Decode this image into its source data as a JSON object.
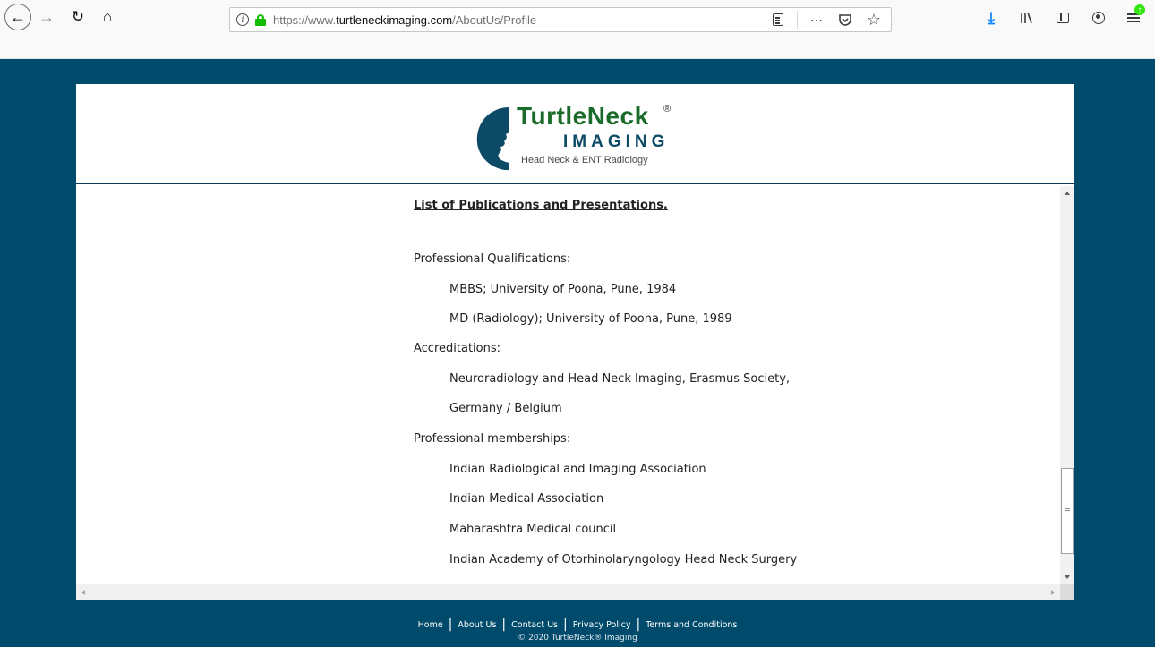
{
  "browser": {
    "url_prefix": "https://www.",
    "url_domain": "turtleneckimaging.com",
    "url_path": "/AboutUs/Profile",
    "icons": [
      "back-icon",
      "forward-icon",
      "reload-icon",
      "home-icon",
      "info-icon",
      "lock-icon",
      "reader-view-icon",
      "more-actions-icon",
      "pocket-icon",
      "bookmark-star-icon",
      "download-icon",
      "library-icon",
      "sidebar-icon",
      "account-icon",
      "menu-icon"
    ],
    "menu_badge": "↑"
  },
  "logo": {
    "name": "TurtleNeck",
    "registered": "®",
    "imaging": "IMAGING",
    "tagline": "Head Neck & ENT Radiology",
    "colors": {
      "name": "#1b6b2b",
      "imaging": "#0d4a66"
    }
  },
  "content": {
    "title": "List of Publications and Presentations.",
    "qualifications_heading": "Professional Qualifications:",
    "qualifications": [
      "MBBS; University of Poona, Pune, 1984",
      "MD (Radiology); University of Poona, Pune, 1989"
    ],
    "accreditations_heading": "Accreditations:",
    "accreditations": [
      "Neuroradiology and Head Neck Imaging, Erasmus Society,",
      "Germany / Belgium"
    ],
    "memberships_heading": "Professional memberships:",
    "memberships": [
      "Indian Radiological and Imaging Association",
      "Indian Medical Association",
      "Maharashtra Medical council",
      "Indian Academy of Otorhinolaryngology Head Neck Surgery"
    ]
  },
  "footer": {
    "links": [
      "Home",
      "About Us",
      "Contact Us",
      "Privacy Policy",
      "Terms and Conditions"
    ],
    "copyright": "© 2020 TurtleNeck® Imaging"
  },
  "colors": {
    "page_bg": "#004a6b",
    "header_border": "#0d3d5a"
  }
}
